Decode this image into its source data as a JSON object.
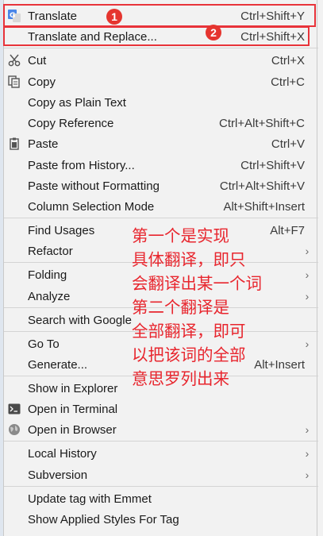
{
  "menu": {
    "items": [
      {
        "label": "Translate",
        "shortcut": "Ctrl+Shift+Y",
        "icon": "google-translate-icon"
      },
      {
        "label": "Translate and Replace...",
        "shortcut": "Ctrl+Shift+X"
      },
      {
        "label": "Cut",
        "shortcut": "Ctrl+X",
        "icon": "scissors-icon"
      },
      {
        "label": "Copy",
        "shortcut": "Ctrl+C",
        "icon": "copy-icon"
      },
      {
        "label": "Copy as Plain Text",
        "shortcut": ""
      },
      {
        "label": "Copy Reference",
        "shortcut": "Ctrl+Alt+Shift+C"
      },
      {
        "label": "Paste",
        "shortcut": "Ctrl+V",
        "icon": "clipboard-icon"
      },
      {
        "label": "Paste from History...",
        "shortcut": "Ctrl+Shift+V"
      },
      {
        "label": "Paste without Formatting",
        "shortcut": "Ctrl+Alt+Shift+V"
      },
      {
        "label": "Column Selection Mode",
        "shortcut": "Alt+Shift+Insert"
      },
      {
        "label": "Find Usages",
        "shortcut": "Alt+F7"
      },
      {
        "label": "Refactor",
        "submenu": true
      },
      {
        "label": "Folding",
        "submenu": true
      },
      {
        "label": "Analyze",
        "submenu": true
      },
      {
        "label": "Search with Google"
      },
      {
        "label": "Go To",
        "submenu": true
      },
      {
        "label": "Generate...",
        "shortcut": "Alt+Insert"
      },
      {
        "label": "Show in Explorer"
      },
      {
        "label": "Open in Terminal",
        "icon": "terminal-icon"
      },
      {
        "label": "Open in Browser",
        "icon": "globe-icon",
        "submenu": true
      },
      {
        "label": "Local History",
        "submenu": true
      },
      {
        "label": "Subversion",
        "submenu": true
      },
      {
        "label": "Update tag with Emmet"
      },
      {
        "label": "Show Applied Styles For Tag"
      }
    ]
  },
  "badges": [
    "1",
    "2"
  ],
  "annotation": {
    "lines": [
      "第一个是实现",
      "具体翻译，即只",
      "会翻译出某一个词",
      "第二个翻译是",
      "全部翻译，即可",
      "以把该词的全部",
      "意思罗列出来"
    ]
  },
  "colors": {
    "highlight": "#e8333a",
    "annotation_text": "#e8262e",
    "menu_bg": "#f2f2f2"
  }
}
